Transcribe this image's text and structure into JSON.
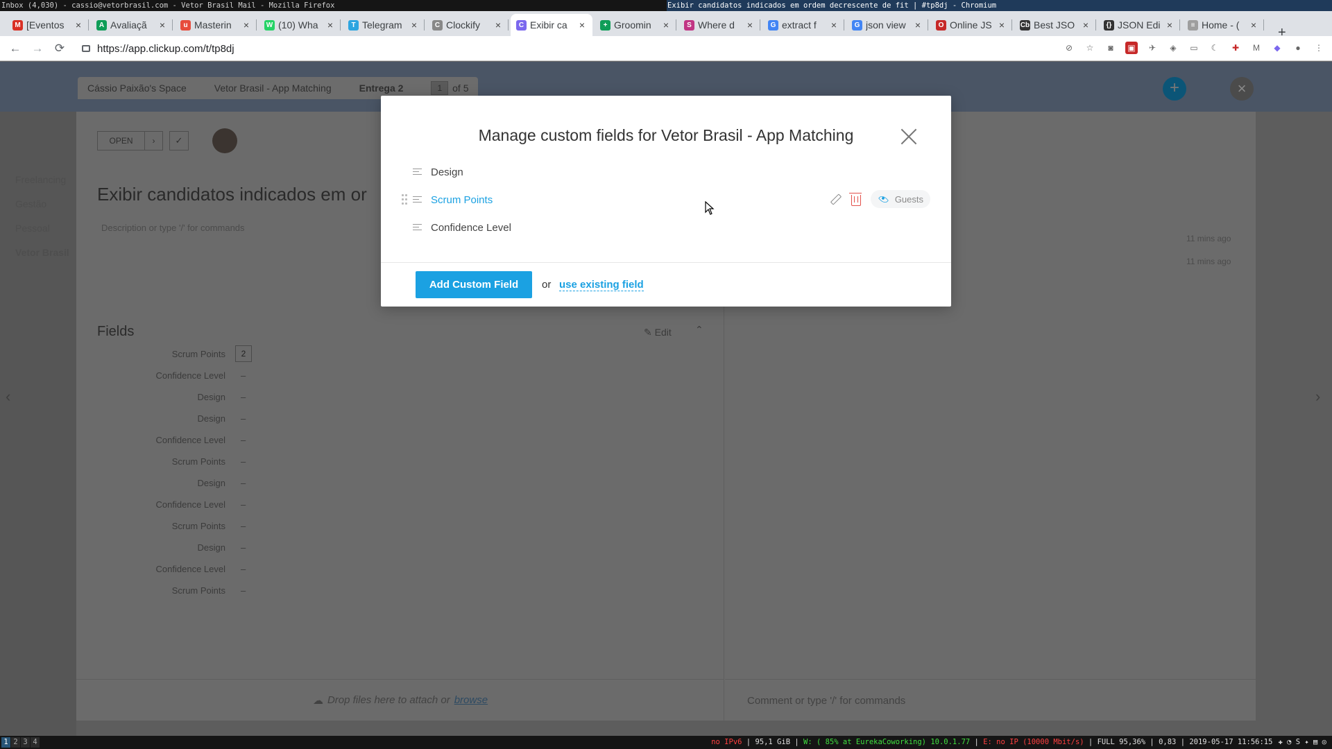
{
  "os": {
    "left_window_title": "Inbox (4,030) - cassio@vetorbrasil.com - Vetor Brasil Mail - Mozilla Firefox",
    "right_window_title": "Exibir candidatos indicados em ordem decrescente de fit | #tp8dj - Chromium"
  },
  "browser": {
    "tabs": [
      {
        "label": "[Eventos",
        "icon": "gmail-icon",
        "color": "#d93025",
        "glyph": "M"
      },
      {
        "label": "Avaliaçã",
        "icon": "green-circle-icon",
        "color": "#0f9d58",
        "glyph": "A"
      },
      {
        "label": "Masterin",
        "icon": "coursera-icon",
        "color": "#e74c3c",
        "glyph": "u"
      },
      {
        "label": "(10) Wha",
        "icon": "whatsapp-icon",
        "color": "#25d366",
        "glyph": "W"
      },
      {
        "label": "Telegram",
        "icon": "telegram-icon",
        "color": "#2ca5e0",
        "glyph": "T"
      },
      {
        "label": "Clockify",
        "icon": "clockify-icon",
        "color": "#888888",
        "glyph": "C"
      },
      {
        "label": "Exibir ca",
        "icon": "clickup-icon",
        "color": "#7b68ee",
        "glyph": "C",
        "active": true
      },
      {
        "label": "Groomin",
        "icon": "sheets-icon",
        "color": "#0f9d58",
        "glyph": "+"
      },
      {
        "label": "Where d",
        "icon": "stackexchange-icon",
        "color": "#c13584",
        "glyph": "S"
      },
      {
        "label": "extract f",
        "icon": "google-icon",
        "color": "#4285f4",
        "glyph": "G"
      },
      {
        "label": "json view",
        "icon": "google-icon",
        "color": "#4285f4",
        "glyph": "G"
      },
      {
        "label": "Online JS",
        "icon": "red-circle-icon",
        "color": "#c62828",
        "glyph": "O"
      },
      {
        "label": "Best JSO",
        "icon": "cb-icon",
        "color": "#333333",
        "glyph": "Cb"
      },
      {
        "label": "JSON Edi",
        "icon": "braces-icon",
        "color": "#333333",
        "glyph": "{}"
      },
      {
        "label": "Home - (",
        "icon": "page-icon",
        "color": "#9e9e9e",
        "glyph": "≡"
      }
    ],
    "url": "https://app.clickup.com/t/tp8dj"
  },
  "app": {
    "breadcrumb": {
      "space": "Cássio Paixão's Space",
      "list": "Vetor Brasil - App Matching",
      "sublist": "Entrega 2",
      "page": "1",
      "of": "of 5"
    },
    "status": "OPEN",
    "task_title": "Exibir candidatos indicados em or",
    "description_placeholder": "Description or type '/' for commands",
    "fields_heading": "Fields",
    "fields_edit": "Edit",
    "fields": [
      {
        "label": "Scrum Points",
        "value": "2"
      },
      {
        "label": "Confidence Level",
        "value": "–"
      },
      {
        "label": "Design",
        "value": "–"
      },
      {
        "label": "Design",
        "value": "–"
      },
      {
        "label": "Confidence Level",
        "value": "–"
      },
      {
        "label": "Scrum Points",
        "value": "–"
      },
      {
        "label": "Design",
        "value": "–"
      },
      {
        "label": "Confidence Level",
        "value": "–"
      },
      {
        "label": "Scrum Points",
        "value": "–"
      },
      {
        "label": "Design",
        "value": "–"
      },
      {
        "label": "Confidence Level",
        "value": "–"
      },
      {
        "label": "Scrum Points",
        "value": "–"
      }
    ],
    "activity_times": [
      "11 mins ago",
      "11 mins ago"
    ],
    "drop_text": "Drop files here to attach or",
    "browse": "browse",
    "comment_placeholder": "Comment or type '/' for commands"
  },
  "modal": {
    "title": "Manage custom fields for Vetor Brasil - App Matching",
    "fields": [
      {
        "name": "Design"
      },
      {
        "name": "Scrum Points",
        "hover": true
      },
      {
        "name": "Confidence Level"
      }
    ],
    "guests_label": "Guests",
    "add_button": "Add Custom Field",
    "or": "or",
    "existing_link": "use existing field"
  },
  "statusbar": {
    "workspaces": [
      "1",
      "2",
      "3",
      "4"
    ],
    "ipv6": "no IPv6",
    "disk": "95,1 GiB",
    "wifi": "W: ( 85% at EurekaCoworking) 10.0.1.77",
    "eth": "E: no IP (10000 Mbit/s)",
    "battery": "FULL 95,36%",
    "load": "0,83",
    "datetime": "2019-05-17 11:56:15"
  }
}
